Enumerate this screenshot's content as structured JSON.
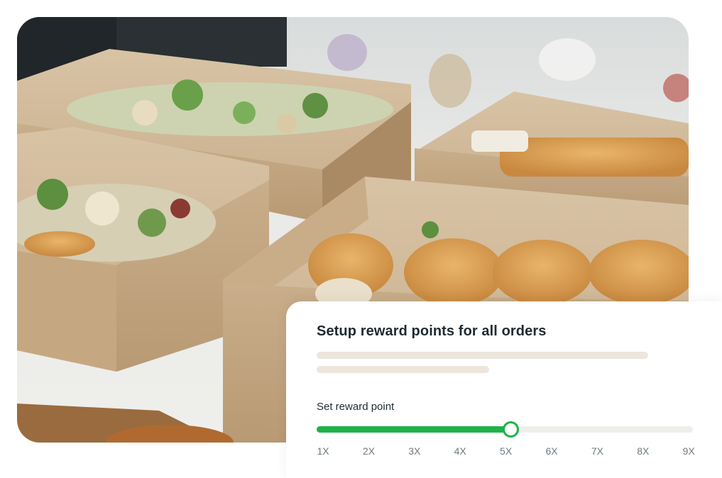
{
  "photo": {
    "subject": "catering boxes with salads and focaccia"
  },
  "card": {
    "title": "Setup reward points for all orders"
  },
  "reward_slider": {
    "label": "Set reward point",
    "ticks": [
      "1X",
      "2X",
      "3X",
      "4X",
      "5X",
      "6X",
      "7X",
      "8X",
      "9X"
    ],
    "selected_value": "5X",
    "selected_index": 4,
    "accent_color": "#1db34a",
    "track_color": "#efeee9"
  }
}
